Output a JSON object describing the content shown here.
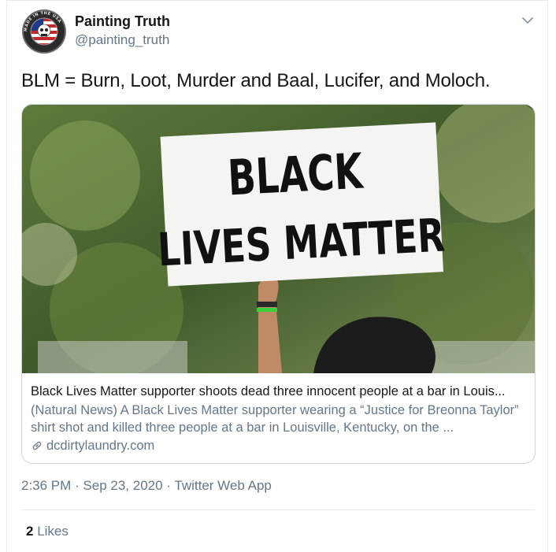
{
  "author": {
    "name": "Painting Truth",
    "handle": "@painting_truth",
    "avatar_ring_text": "MADE IN THE USA"
  },
  "tweet": {
    "text": "BLM = Burn, Loot, Murder and Baal, Lucifer, and Moloch."
  },
  "card": {
    "image_sign_line1": "BLACK",
    "image_sign_line2": "LIVES MATTER",
    "title": "Black Lives Matter supporter shoots dead three innocent people at a bar in Louis...",
    "description": "(Natural News) A Black Lives Matter supporter wearing a “Justice for Breonna Taylor” shirt shot and killed three people at a bar in Louisville, Kentucky, on the ...",
    "domain": "dcdirtylaundry.com",
    "link_icon": "link-icon"
  },
  "meta": {
    "time": "2:36 PM",
    "sep1": " · ",
    "date": "Sep 23, 2020",
    "sep2": " · ",
    "source": "Twitter Web App"
  },
  "stats": {
    "likes_count": "2",
    "likes_label": " Likes"
  },
  "colors": {
    "primary_text": "#14171a",
    "secondary_text": "#657786",
    "border": "#ccd6dd",
    "divider": "#e6ecf0"
  }
}
